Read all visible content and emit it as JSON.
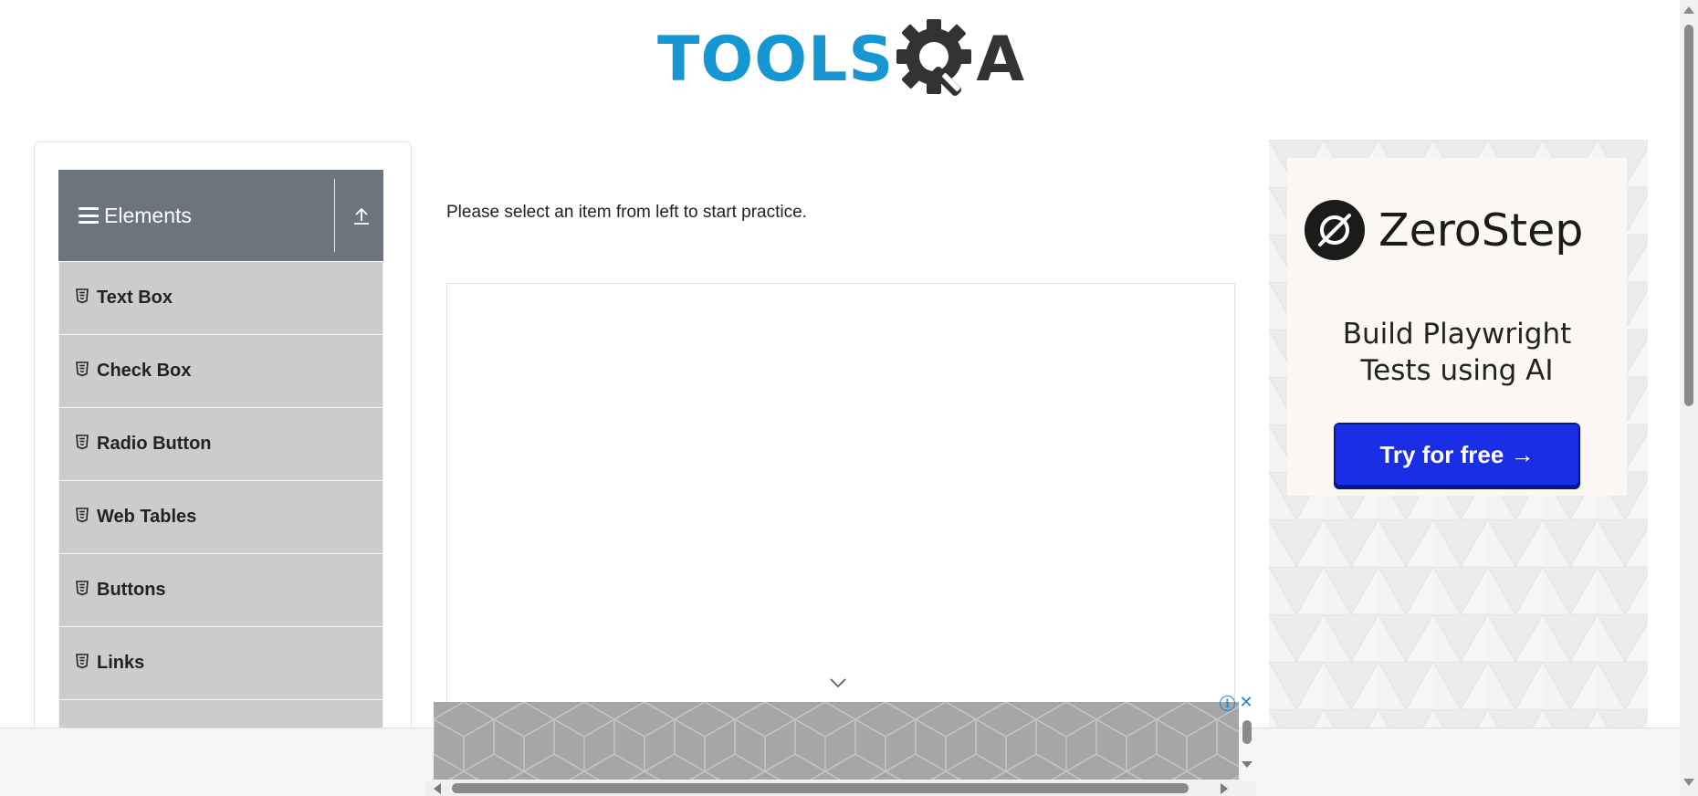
{
  "header": {
    "logo_part1": "TOOLS",
    "logo_part2": "A",
    "logo_icon": "gear-magnifier-icon"
  },
  "sidebar": {
    "group_title": "Elements",
    "group_icon": "hamburger-icon",
    "collapse_icon": "collapse-up-icon",
    "items": [
      {
        "label": "Text Box",
        "icon": "html5-icon"
      },
      {
        "label": "Check Box",
        "icon": "html5-icon"
      },
      {
        "label": "Radio Button",
        "icon": "html5-icon"
      },
      {
        "label": "Web Tables",
        "icon": "html5-icon"
      },
      {
        "label": "Buttons",
        "icon": "html5-icon"
      },
      {
        "label": "Links",
        "icon": "html5-icon"
      },
      {
        "label": "",
        "icon": "html5-icon"
      }
    ]
  },
  "main": {
    "intro_text": "Please select an item from left to start practice."
  },
  "right_ad": {
    "brand": "ZeroStep",
    "tagline_line1": "Build Playwright",
    "tagline_line2": "Tests using AI",
    "cta_label": "Try for free →",
    "cta_color": "#1a2ee6"
  },
  "bottom_ad": {
    "info_label": "i",
    "close_label": "✕"
  },
  "colors": {
    "logo_blue": "#1797d2",
    "logo_dark": "#333333",
    "group_header_bg": "#6c757d",
    "menu_item_bg": "#cccccc"
  }
}
